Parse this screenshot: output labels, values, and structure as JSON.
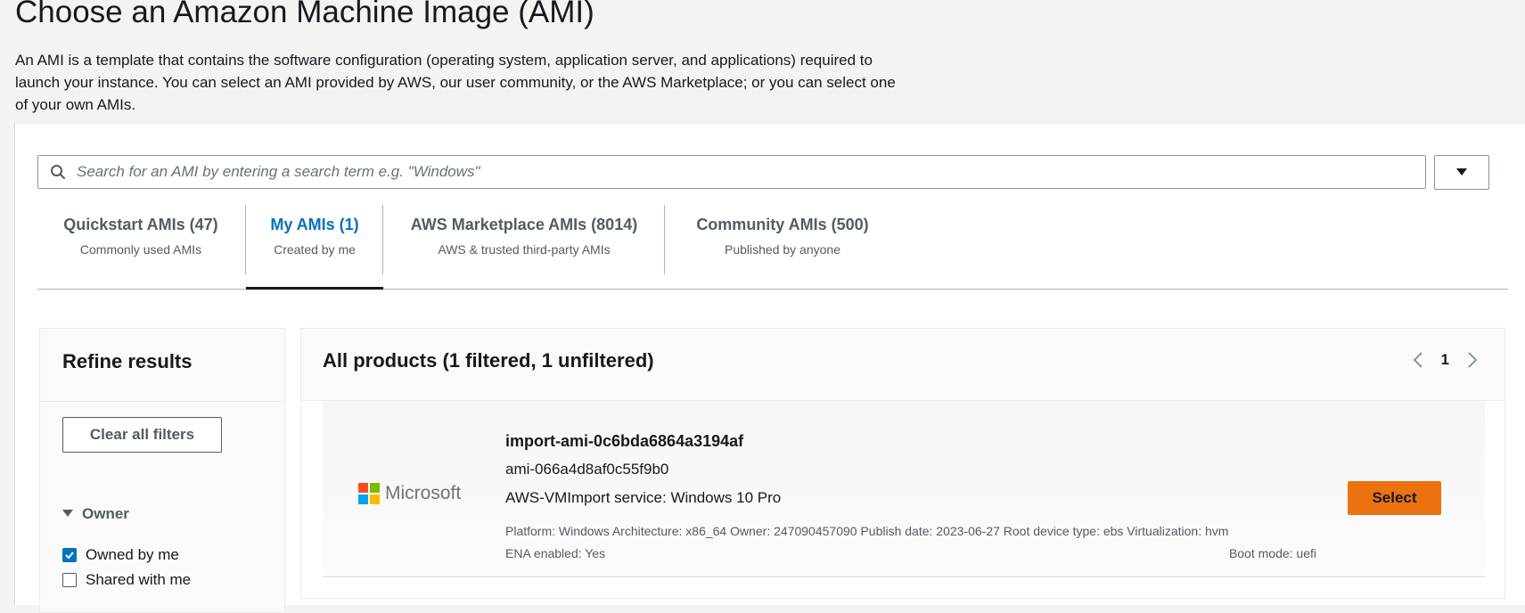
{
  "page": {
    "title": "Choose an Amazon Machine Image (AMI)",
    "description": "An AMI is a template that contains the software configuration (operating system, application server, and applications) required to launch your instance. You can select an AMI provided by AWS, our user community, or the AWS Marketplace; or you can select one of your own AMIs."
  },
  "search": {
    "placeholder": "Search for an AMI by entering a search term e.g. \"Windows\"",
    "value": ""
  },
  "tabs": [
    {
      "label": "Quickstart AMIs (47)",
      "sublabel": "Commonly used AMIs",
      "active": false
    },
    {
      "label": "My AMIs (1)",
      "sublabel": "Created by me",
      "active": true
    },
    {
      "label": "AWS Marketplace AMIs (8014)",
      "sublabel": "AWS & trusted third-party AMIs",
      "active": false
    },
    {
      "label": "Community AMIs (500)",
      "sublabel": "Published by anyone",
      "active": false
    }
  ],
  "refine": {
    "title": "Refine results",
    "clear_label": "Clear all filters",
    "owner_label": "Owner",
    "options": [
      {
        "label": "Owned by me",
        "checked": true
      },
      {
        "label": "Shared with me",
        "checked": false
      }
    ]
  },
  "results": {
    "title": "All products (1 filtered, 1 unfiltered)",
    "page": "1",
    "items": [
      {
        "logo_text": "Microsoft",
        "name": "import-ami-0c6bda6864a3194af",
        "id": "ami-066a4d8af0c55f9b0",
        "description": "AWS-VMImport service: Windows 10 Pro",
        "meta": "Platform: Windows Architecture: x86_64 Owner: 247090457090 Publish date: 2023-06-27 Root device type: ebs Virtualization: hvm",
        "ena": "ENA enabled: Yes",
        "boot_mode": "Boot mode: uefi",
        "select_label": "Select"
      }
    ]
  },
  "colors": {
    "accent": "#0073bb",
    "select_button": "#ec7211",
    "ms_red": "#f25022",
    "ms_green": "#7fba00",
    "ms_blue": "#00a4ef",
    "ms_yellow": "#ffb900"
  }
}
